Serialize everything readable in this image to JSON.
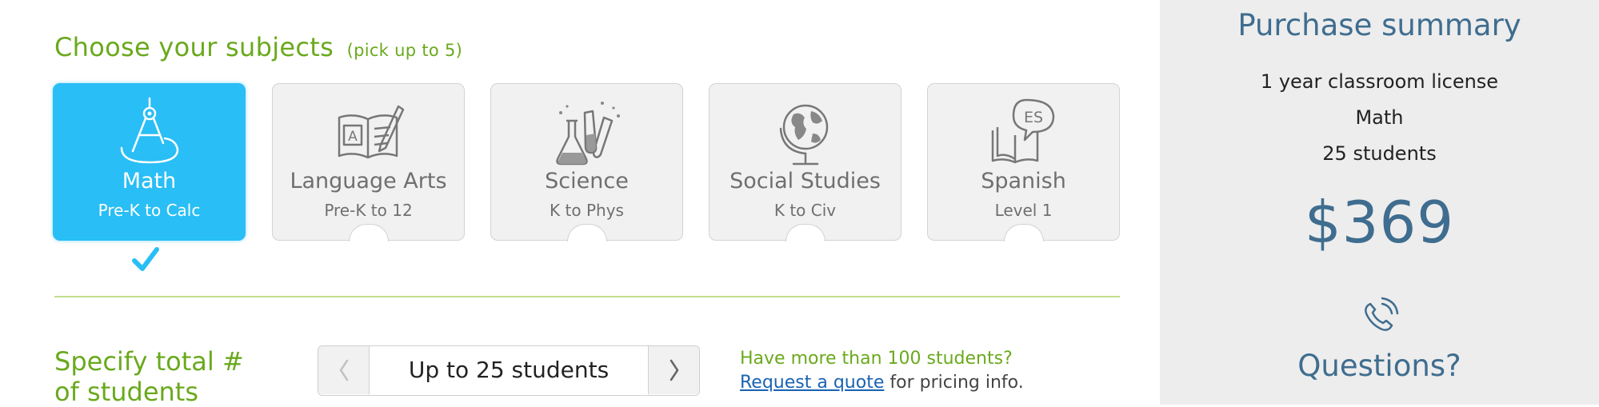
{
  "subjects_section": {
    "heading": "Choose your subjects",
    "heading_note": "(pick up to 5)",
    "cards": [
      {
        "title": "Math",
        "range": "Pre-K to Calc",
        "icon": "compass-icon",
        "selected": true
      },
      {
        "title": "Language Arts",
        "range": "Pre-K to 12",
        "icon": "book-pencil-icon",
        "selected": false
      },
      {
        "title": "Science",
        "range": "K to Phys",
        "icon": "lab-beaker-icon",
        "selected": false
      },
      {
        "title": "Social Studies",
        "range": "K to Civ",
        "icon": "globe-icon",
        "selected": false
      },
      {
        "title": "Spanish",
        "range": "Level 1",
        "icon": "spanish-book-bubble-icon",
        "selected": false,
        "icon_text": "ES"
      }
    ]
  },
  "students_section": {
    "label_line1": "Specify total #",
    "label_line2": "of students",
    "stepper_value": "Up to 25 students",
    "prev_icon": "chevron-left-icon",
    "next_icon": "chevron-right-icon",
    "quote_line1": "Have more than 100 students?",
    "quote_link": "Request a quote",
    "quote_rest": "for pricing info."
  },
  "summary": {
    "title": "Purchase summary",
    "license": "1 year classroom license",
    "subject": "Math",
    "students": "25 students",
    "price": "$369",
    "questions_icon": "phone-icon",
    "questions": "Questions?"
  },
  "colors": {
    "accent_green": "#6aa91d",
    "selected_blue": "#29bef5",
    "summary_blue": "#3f6d8f",
    "link_blue": "#1a62b3"
  }
}
